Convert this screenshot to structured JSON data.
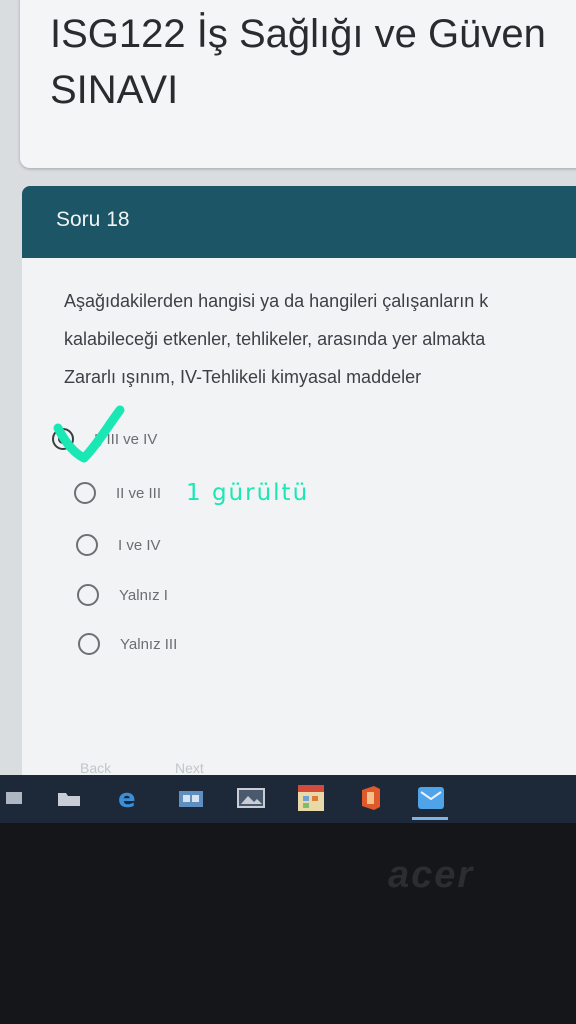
{
  "page": {
    "title_line1": "ISG122 İş Sağlığı ve Güven",
    "title_line2": "SINAVI"
  },
  "question": {
    "number": "Soru 18",
    "text_lines": [
      "Aşağıdakilerden hangisi ya da hangileri çalışanların k",
      "kalabileceği etkenler, tehlikeler, arasında yer almakta",
      "Zararlı ışınım, IV-Tehlikeli kimyasal maddeler"
    ],
    "options": [
      {
        "label": "I, III ve IV",
        "selected": true
      },
      {
        "label": "II ve III",
        "selected": false
      },
      {
        "label": "I ve IV",
        "selected": false
      },
      {
        "label": "Yalnız I",
        "selected": false
      },
      {
        "label": "Yalnız III",
        "selected": false
      }
    ],
    "handwritten_note": "1 gürültü"
  },
  "navigation": {
    "back": "Back",
    "next": "Next"
  },
  "laptop": {
    "brand": "acer"
  },
  "colors": {
    "header": "#1c5566",
    "annotation": "#19e8b5",
    "taskbar": "#1d2838"
  },
  "taskbar_icons": [
    "task-view-icon",
    "file-explorer-icon",
    "edge-browser-icon",
    "store-icon",
    "photos-icon",
    "calendar-app-icon",
    "office-icon",
    "mail-app-icon"
  ]
}
